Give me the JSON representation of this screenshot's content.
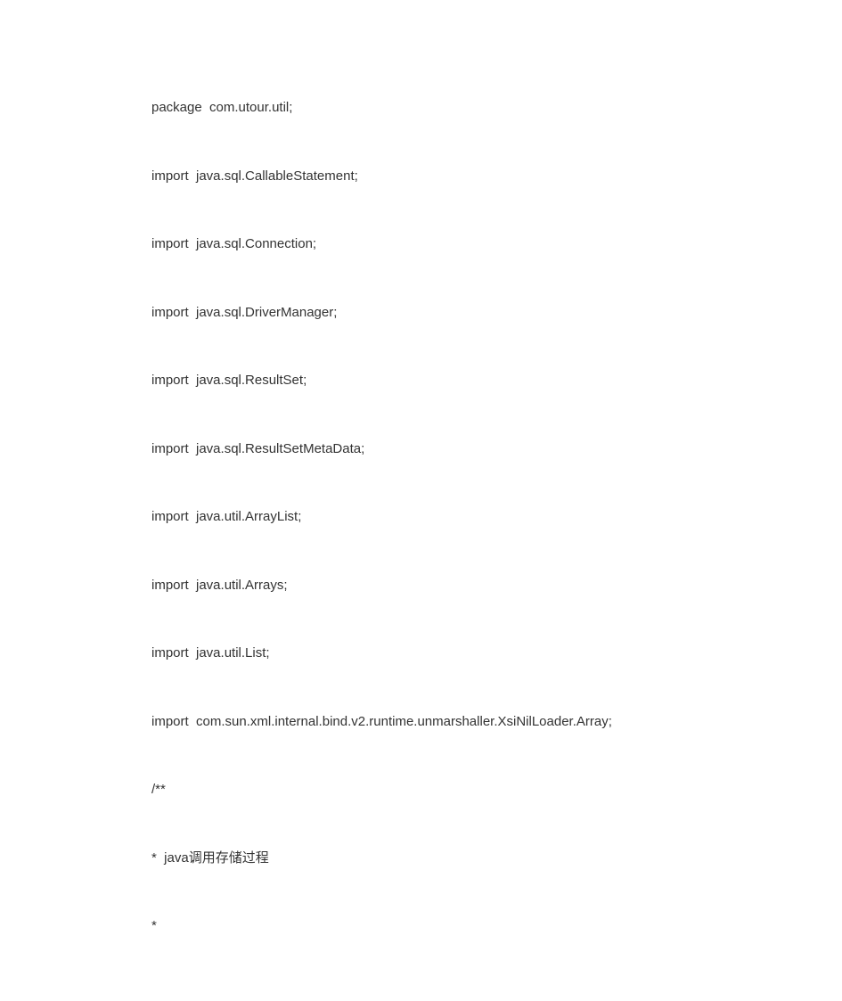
{
  "lines": [
    "package  com.utour.util;",
    "import  java.sql.CallableStatement;",
    "import  java.sql.Connection;",
    "import  java.sql.DriverManager;",
    "import  java.sql.ResultSet;",
    "import  java.sql.ResultSetMetaData;",
    "import  java.util.ArrayList;",
    "import  java.util.Arrays;",
    "import  java.util.List;",
    "import  com.sun.xml.internal.bind.v2.runtime.unmarshaller.XsiNilLoader.Array;",
    "/**",
    "*  java调用存储过程",
    "*"
  ]
}
